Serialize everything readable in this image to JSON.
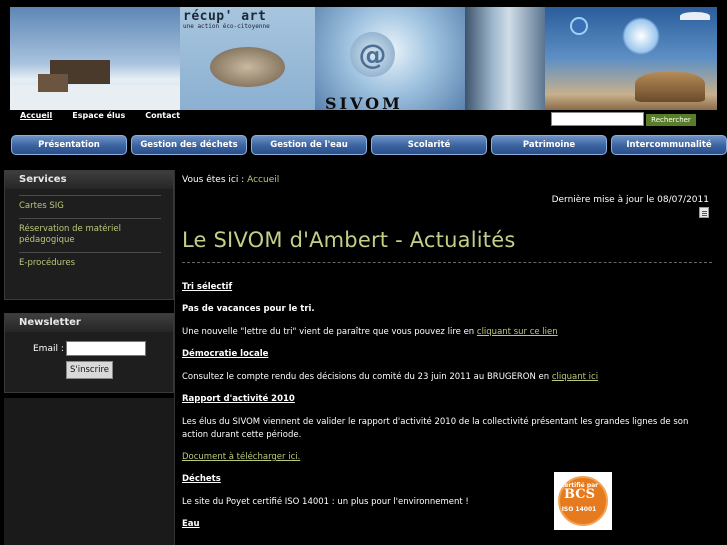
{
  "banner": {
    "recup": "récup' art",
    "recup_sub": "une action éco-citoyenne",
    "sivom": "SIVOM"
  },
  "topnav": [
    {
      "label": "Accueil"
    },
    {
      "label": "Espace élus"
    },
    {
      "label": "Contact"
    }
  ],
  "search": {
    "button": "Rechercher",
    "value": ""
  },
  "mainnav": [
    {
      "label": "Présentation"
    },
    {
      "label": "Gestion des déchets"
    },
    {
      "label": "Gestion de l'eau"
    },
    {
      "label": "Scolarité"
    },
    {
      "label": "Patrimoine"
    },
    {
      "label": "Intercommunalité"
    }
  ],
  "services": {
    "title": "Services",
    "items": [
      {
        "label": "Cartes SIG"
      },
      {
        "label": "Réservation de matériel pédagogique"
      },
      {
        "label": "E-procédures"
      }
    ]
  },
  "newsletter": {
    "title": "Newsletter",
    "email_label": "Email :",
    "button": "S'inscrire"
  },
  "content": {
    "crumb_prefix": "Vous êtes ici :",
    "crumb_link": "Accueil",
    "updated": "Dernière mise à jour le 08/07/2011",
    "title": "Le SIVOM d'Ambert - Actualités",
    "h_tri": "Tri sélectif",
    "tri_bold": "Pas de vacances pour le tri.",
    "tri_text": "Une nouvelle \"lettre du tri\" vient de paraître que vous pouvez lire en",
    "tri_link": "cliquant sur ce lien",
    "h_demo": "Démocratie locale",
    "demo_text": "Consultez le compte rendu des décisions du comité du 23 juin 2011 au BRUGERON en",
    "demo_link": "cliquant ici",
    "h_rapport": "Rapport d'activité 2010",
    "rapport_text": "Les élus du SIVOM  viennent de valider le rapport  d'activité 2010 de la collectivité présentant les grandes lignes de son action durant cette période.",
    "rapport_link": "Document à télécharger ici.",
    "h_dechets": "Déchets",
    "dechets_text": "Le site du Poyet certifié ISO 14001 : un plus pour l'environnement !",
    "h_eau": "Eau",
    "badge_text": "BCS",
    "badge_iso": "ISO 14001",
    "badge_top": "Certifié par"
  }
}
